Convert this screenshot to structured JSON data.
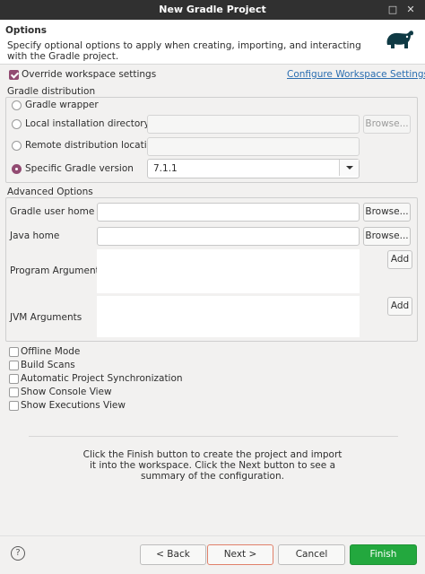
{
  "window": {
    "title": "New Gradle Project"
  },
  "header": {
    "title": "Options",
    "description": "Specify optional options to apply when creating, importing, and interacting with the Gradle project."
  },
  "override": {
    "label": "Override workspace settings",
    "checked": true,
    "link": "Configure Workspace Settings..."
  },
  "gradle_distribution": {
    "legend": "Gradle distribution",
    "wrapper_label": "Gradle wrapper",
    "local_label": "Local installation directory",
    "local_browse": "Browse...",
    "remote_label": "Remote distribution location",
    "specific_label": "Specific Gradle version",
    "version_value": "7.1.1"
  },
  "advanced": {
    "legend": "Advanced Options",
    "user_home_label": "Gradle user home",
    "user_home_browse": "Browse...",
    "java_home_label": "Java home",
    "java_home_browse": "Browse...",
    "program_args_label": "Program Arguments",
    "program_args_add": "Add",
    "jvm_args_label": "JVM Arguments",
    "jvm_args_add": "Add"
  },
  "options": [
    {
      "label": "Offline Mode",
      "checked": false
    },
    {
      "label": "Build Scans",
      "checked": false
    },
    {
      "label": "Automatic Project Synchronization",
      "checked": false
    },
    {
      "label": "Show Console View",
      "checked": false
    },
    {
      "label": "Show Executions View",
      "checked": false
    }
  ],
  "info_text": "Click the Finish button to create the project and import it into the workspace. Click the Next button to see a summary of the configuration.",
  "footer": {
    "help": "?",
    "back": "< Back",
    "next": "Next >",
    "cancel": "Cancel",
    "finish": "Finish"
  },
  "colors": {
    "accent": "#924b72",
    "finish": "#23a83e",
    "link": "#2a6db0",
    "logo": "#0f3a44"
  },
  "icons": {
    "logo": "gradle-elephant-icon",
    "help": "help-icon",
    "dropdown": "chevron-down-icon"
  }
}
